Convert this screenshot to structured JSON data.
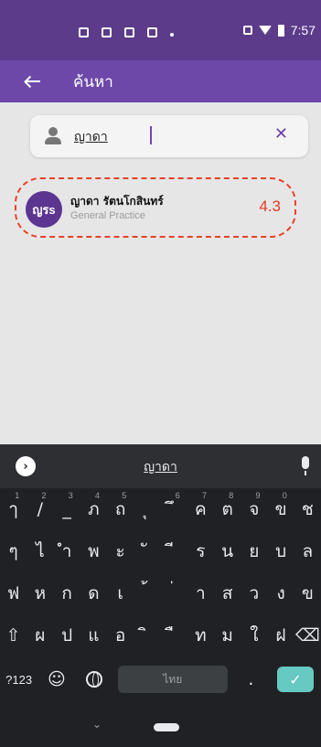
{
  "status_bar": {
    "time": "7:57",
    "icons": [
      "image-icon",
      "document-icon",
      "clipboard-icon",
      "gmail-icon",
      "dot-icon",
      "vibrate-icon",
      "wifi-icon",
      "battery-icon"
    ]
  },
  "app_bar": {
    "title": "ค้นหา",
    "back_icon": "arrow-back-icon"
  },
  "search": {
    "value": "ญาดา",
    "clear_icon": "close-icon",
    "user_icon": "person-icon"
  },
  "results": [
    {
      "initials": "ญรs",
      "name": "ญาดา รัตนโกสินทร์",
      "subtitle": "General Practice",
      "score": "4.3"
    }
  ],
  "keyboard": {
    "suggestion": "ญาดา",
    "row1": [
      "ๅ",
      "/",
      "_",
      "ภ",
      "ถ",
      "ุ",
      "ึ",
      "ค",
      "ต",
      "จ",
      "ข",
      "ช"
    ],
    "row1_hints": [
      "1",
      "2",
      "3",
      "4",
      "5",
      "",
      "6",
      "7",
      "8",
      "9",
      "0",
      ""
    ],
    "row2": [
      "ๆ",
      "ไ",
      "ำ",
      "พ",
      "ะ",
      "ั",
      "ี",
      "ร",
      "น",
      "ย",
      "บ",
      "ล"
    ],
    "row3": [
      "ฟ",
      "ห",
      "ก",
      "ด",
      "เ",
      "้",
      "่",
      "า",
      "ส",
      "ว",
      "ง",
      "ข"
    ],
    "row4": [
      "ผ",
      "ป",
      "แ",
      "อ",
      "ิ",
      "ื",
      "ท",
      "ม",
      "ใ",
      "ฝ"
    ],
    "row5": {
      "symbols": "?123",
      "emoji": "☺",
      "space": "ไทย",
      "period": ".",
      "enter": "✓"
    }
  },
  "colors": {
    "status_bar": "#5b3b8a",
    "app_bar": "#6d48a9",
    "highlight": "#e8402a"
  }
}
